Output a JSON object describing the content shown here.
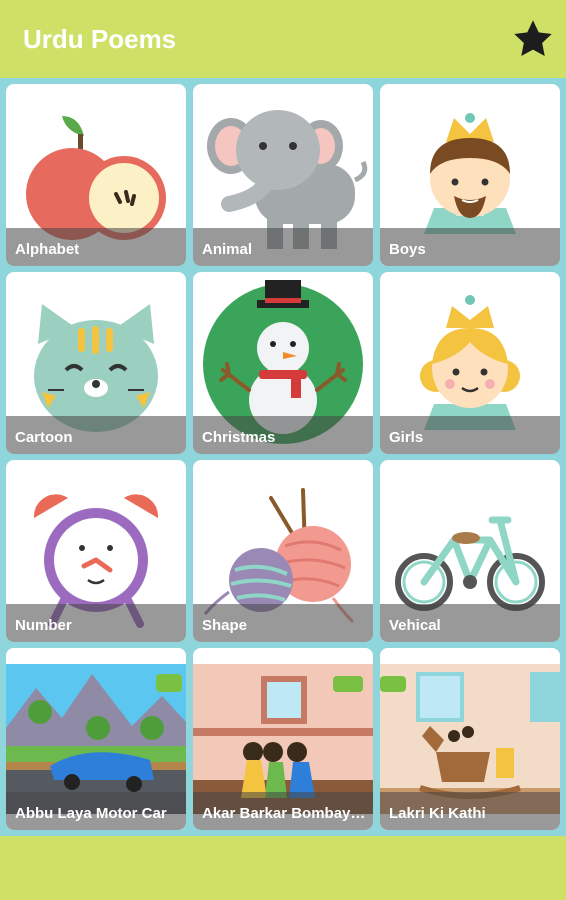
{
  "app": {
    "title": "Urdu Poems",
    "favorites_icon": "star-icon"
  },
  "colors": {
    "appbar": "#cfe066",
    "grid_background": "#8fd6dc",
    "tile_background": "#ffffff"
  },
  "categories": [
    {
      "label": "Alphabet",
      "icon": "apple-icon"
    },
    {
      "label": "Animal",
      "icon": "elephant-icon"
    },
    {
      "label": "Boys",
      "icon": "prince-icon"
    },
    {
      "label": "Cartoon",
      "icon": "cat-icon"
    },
    {
      "label": "Christmas",
      "icon": "snowman-icon"
    },
    {
      "label": "Girls",
      "icon": "princess-icon"
    },
    {
      "label": "Number",
      "icon": "alarm-clock-icon"
    },
    {
      "label": "Shape",
      "icon": "yarn-balls-icon"
    },
    {
      "label": "Vehical",
      "icon": "bicycle-icon"
    }
  ],
  "videos": [
    {
      "label": "Abbu Laya Motor Car",
      "thumbnail": "car-scene-thumbnail"
    },
    {
      "label": "Akar Barkar Bombay Bo",
      "thumbnail": "kids-room-thumbnail"
    },
    {
      "label": "Lakri Ki Kathi",
      "thumbnail": "rocking-horse-thumbnail"
    }
  ]
}
